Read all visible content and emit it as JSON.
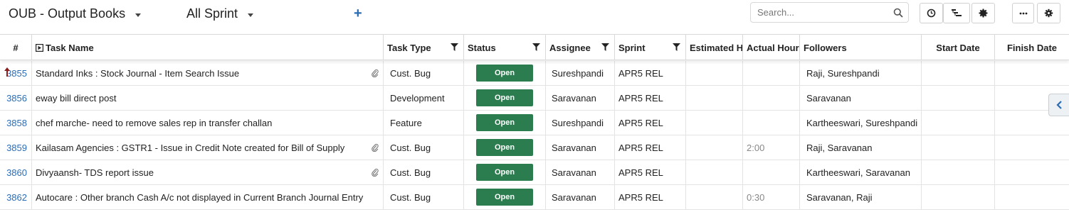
{
  "toolbar": {
    "project_label": "OUB - Output Books",
    "sprint_label": "All Sprint",
    "add_symbol": "+",
    "search_placeholder": "Search..."
  },
  "columns": {
    "num": "#",
    "task_name": "Task Name",
    "task_type": "Task Type",
    "status": "Status",
    "assignee": "Assignee",
    "sprint": "Sprint",
    "estimated_hours": "Estimated H",
    "actual_hours": "Actual Hour",
    "followers": "Followers",
    "start_date": "Start Date",
    "finish_date": "Finish Date"
  },
  "rows": [
    {
      "id": "3855",
      "name": "Standard Inks : Stock Journal - Item Search Issue",
      "attachment": true,
      "priority_up": true,
      "type": "Cust. Bug",
      "status": "Open",
      "assignee": "Sureshpandi",
      "sprint": "APR5 REL",
      "estimated": "",
      "actual": "",
      "followers": "Raji, Sureshpandi",
      "start": "",
      "finish": ""
    },
    {
      "id": "3856",
      "name": "eway bill direct post",
      "attachment": false,
      "priority_up": false,
      "type": "Development",
      "status": "Open",
      "assignee": "Saravanan",
      "sprint": "APR5 REL",
      "estimated": "",
      "actual": "",
      "followers": "Saravanan",
      "start": "",
      "finish": ""
    },
    {
      "id": "3858",
      "name": "chef marche- need to remove sales rep in transfer challan",
      "attachment": false,
      "priority_up": false,
      "type": "Feature",
      "status": "Open",
      "assignee": "Sureshpandi",
      "sprint": "APR5 REL",
      "estimated": "",
      "actual": "",
      "followers": "Kartheeswari, Sureshpandi",
      "start": "",
      "finish": ""
    },
    {
      "id": "3859",
      "name": "Kailasam Agencies : GSTR1 - Issue in Credit Note created for Bill of Supply",
      "attachment": true,
      "priority_up": false,
      "type": "Cust. Bug",
      "status": "Open",
      "assignee": "Saravanan",
      "sprint": "APR5 REL",
      "estimated": "",
      "actual": "2:00",
      "followers": "Raji, Saravanan",
      "start": "",
      "finish": ""
    },
    {
      "id": "3860",
      "name": "Divyaansh- TDS report issue",
      "attachment": true,
      "priority_up": false,
      "type": "Cust. Bug",
      "status": "Open",
      "assignee": "Saravanan",
      "sprint": "APR5 REL",
      "estimated": "",
      "actual": "",
      "followers": "Kartheeswari, Saravanan",
      "start": "",
      "finish": ""
    },
    {
      "id": "3862",
      "name": "Autocare : Other branch Cash A/c not displayed in Current Branch Journal Entry",
      "attachment": false,
      "priority_up": false,
      "type": "Cust. Bug",
      "status": "Open",
      "assignee": "Saravanan",
      "sprint": "APR5 REL",
      "estimated": "",
      "actual": "0:30",
      "followers": "Saravanan, Raji",
      "start": "",
      "finish": ""
    }
  ],
  "colors": {
    "status_open": "#2b7d4f",
    "link": "#2a6db5",
    "border": "#d9d9d9"
  },
  "icons": {
    "project_dropdown": "chevron-down-icon",
    "sprint_dropdown": "chevron-down-icon",
    "add": "plus-icon",
    "search": "search-icon",
    "history": "clock-icon",
    "hierarchy": "hierarchy-icon",
    "settings_gear": "gear-icon",
    "more": "more-icon",
    "config": "settings-icon",
    "task_expand": "expand-icon",
    "attachment": "paperclip-icon",
    "priority": "arrow-up-icon",
    "side_toggle": "chevron-left-icon"
  }
}
